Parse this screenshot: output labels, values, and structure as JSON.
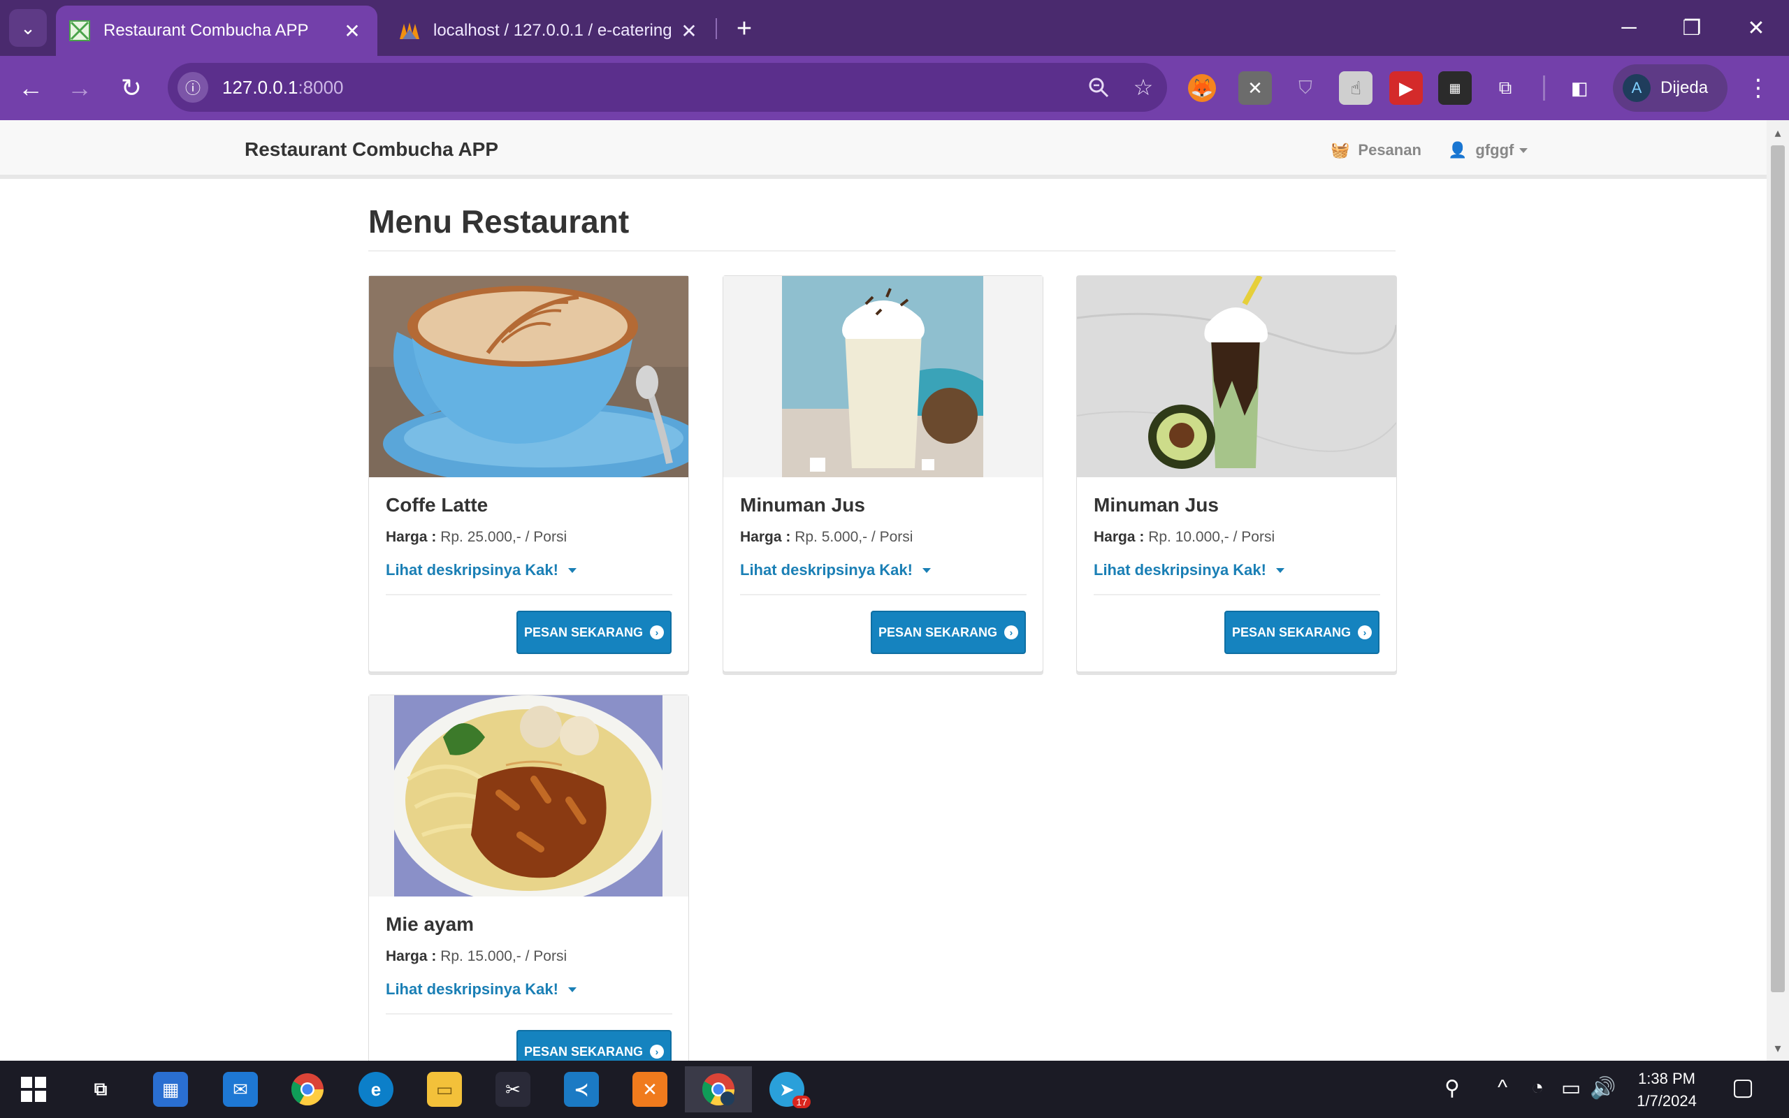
{
  "browser": {
    "tabs": [
      {
        "title": "Restaurant Combucha APP",
        "active": true
      },
      {
        "title": "localhost / 127.0.0.1 / e-catering",
        "active": false
      }
    ],
    "url_host": "127.0.0.1",
    "url_port": ":8000",
    "profile_name": "Dijeda",
    "accent": "#7340aa",
    "tabbar_color": "#4a2a6e"
  },
  "navbar": {
    "brand": "Restaurant Combucha APP",
    "orders": "Pesanan",
    "user": "gfggf"
  },
  "main": {
    "heading": "Menu Restaurant",
    "price_label": "Harga :",
    "desc_toggle": "Lihat deskripsinya Kak!",
    "order_button": "PESAN SEKARANG",
    "items": [
      {
        "name": "Coffe Latte",
        "price": "Rp. 25.000,- / Porsi",
        "image": "latte-image"
      },
      {
        "name": "Minuman Jus",
        "price": "Rp. 5.000,- / Porsi",
        "image": "coconut-shake-image"
      },
      {
        "name": "Minuman Jus",
        "price": "Rp. 10.000,- / Porsi",
        "image": "avocado-shake-image"
      },
      {
        "name": "Mie ayam",
        "price": "Rp. 15.000,- / Porsi",
        "image": "mie-ayam-image"
      }
    ],
    "button_color": "#1583bf",
    "link_color": "#1a7fb5"
  },
  "taskbar": {
    "time": "1:38 PM",
    "date": "1/7/2024",
    "telegram_badge": "17"
  }
}
